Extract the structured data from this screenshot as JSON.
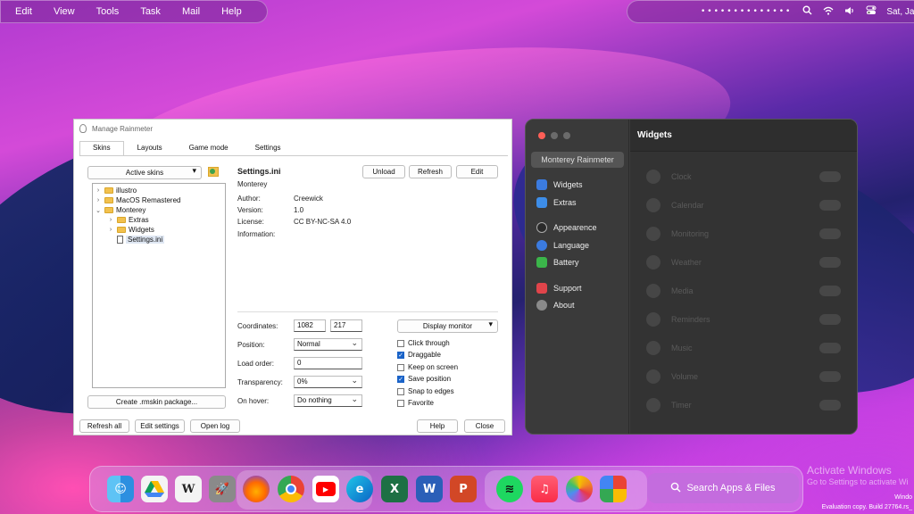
{
  "menubar": {
    "items": [
      "Edit",
      "View",
      "Tools",
      "Task",
      "Mail",
      "Help"
    ],
    "dots": "••••••••••••••",
    "clock": "Sat, Jan"
  },
  "rainmeter": {
    "title": "Manage Rainmeter",
    "tabs": [
      "Skins",
      "Layouts",
      "Game mode",
      "Settings"
    ],
    "active_skins_label": "Active skins",
    "tree": [
      "illustro",
      "MacOS Remastered",
      "Monterey",
      "Extras",
      "Widgets",
      "Settings.ini"
    ],
    "file_title": "Settings.ini",
    "file_subtitle": "Monterey",
    "buttons": {
      "unload": "Unload",
      "refresh": "Refresh",
      "edit": "Edit",
      "create": "Create .rmskin package...",
      "refresh_all": "Refresh all",
      "edit_settings": "Edit settings",
      "open_log": "Open log",
      "help": "Help",
      "close": "Close"
    },
    "meta": {
      "author_label": "Author:",
      "author": "Creewick",
      "version_label": "Version:",
      "version": "1.0",
      "license_label": "License:",
      "license": "CC BY-NC-SA 4.0",
      "info_label": "Information:"
    },
    "settings": {
      "coordinates_label": "Coordinates:",
      "x": "1082",
      "y": "217",
      "position_label": "Position:",
      "position": "Normal",
      "load_order_label": "Load order:",
      "load_order": "0",
      "transparency_label": "Transparency:",
      "transparency": "0%",
      "on_hover_label": "On hover:",
      "on_hover": "Do nothing",
      "display_monitor": "Display monitor"
    },
    "checkboxes": [
      {
        "label": "Click through",
        "checked": false
      },
      {
        "label": "Draggable",
        "checked": true
      },
      {
        "label": "Keep on screen",
        "checked": false
      },
      {
        "label": "Save position",
        "checked": true
      },
      {
        "label": "Snap to edges",
        "checked": false
      },
      {
        "label": "Favorite",
        "checked": false
      }
    ]
  },
  "widgets_app": {
    "sidebar_header": "Monterey Rainmeter",
    "sidebar": [
      "Widgets",
      "Extras",
      "Appearence",
      "Language",
      "Battery",
      "Support",
      "About"
    ],
    "title": "Widgets",
    "rows": [
      "Clock",
      "Calendar",
      "Monitoring",
      "Weather",
      "Media",
      "Reminders",
      "Music",
      "Volume",
      "Timer"
    ]
  },
  "dock": {
    "apps": [
      "Finder",
      "Drive",
      "Wikipedia",
      "Launchpad",
      "Firefox",
      "Chrome",
      "YouTube",
      "Edge",
      "Excel",
      "Word",
      "PowerPoint",
      "Spotify",
      "Music",
      "Photos",
      "Pinwheel"
    ],
    "search": "Search Apps & Files"
  },
  "watermark": {
    "line1": "Activate Windows",
    "line2": "Go to Settings to activate Wi",
    "line3": "Windo",
    "line4": "Evaluation copy. Build 27764.rs_"
  }
}
